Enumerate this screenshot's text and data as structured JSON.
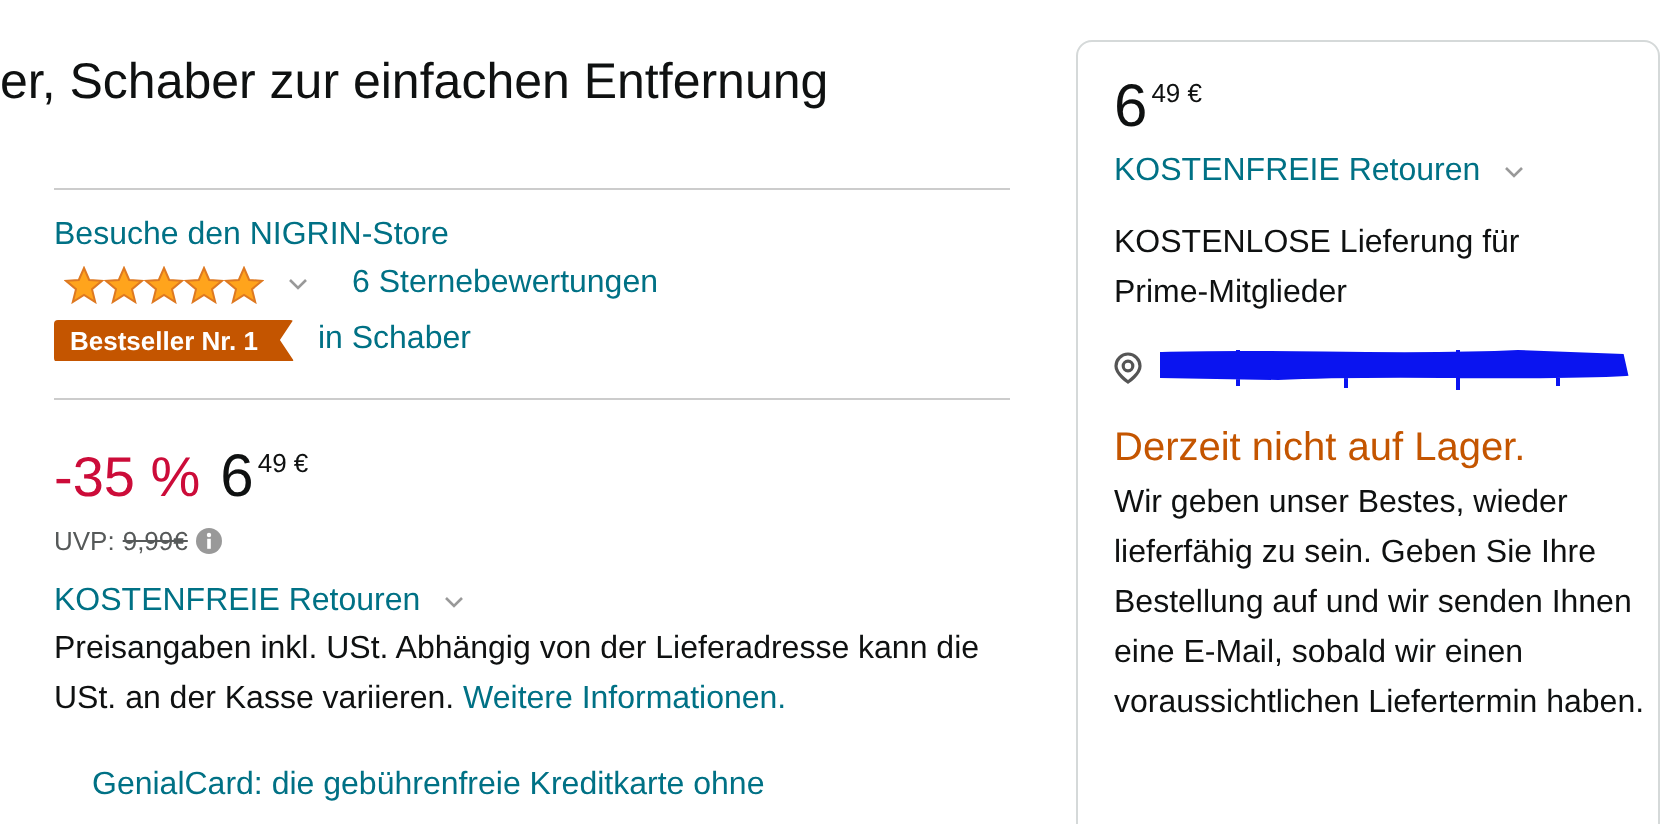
{
  "title": "er, Schaber zur einfachen Entfernung",
  "store_link": "Besuche den NIGRIN-Store",
  "rating": {
    "stars": 5,
    "count_link": "6 Sternebewertungen"
  },
  "bestseller": {
    "badge": "Bestseller Nr. 1",
    "category_link": "in Schaber"
  },
  "price": {
    "discount": "-35 %",
    "whole": "6",
    "fraction": "49",
    "currency": "€",
    "list_label": "UVP:",
    "list_price": "9,99€"
  },
  "returns_link": "KOSTENFREIE Retouren",
  "tax_note": "Preisangaben inkl. USt. Abhängig von der Lieferadresse kann die USt. an der Kasse variieren.",
  "tax_link": "Weitere Informationen.",
  "promo_link": "GenialCard: die gebührenfreie Kreditkarte ohne",
  "buybox": {
    "price": {
      "whole": "6",
      "fraction": "49",
      "currency": "€"
    },
    "returns_link": "KOSTENFREIE Retouren",
    "delivery": "KOSTENLOSE Lieferung für Prime-Mitglieder",
    "availability": "Derzeit nicht auf Lager.",
    "availability_note": "Wir geben unser Bestes, wieder lieferfähig zu sein. Geben Sie Ihre Bestellung auf und wir senden Ihnen eine E-Mail, sobald wir einen voraussichtlichen Liefertermin haben."
  }
}
